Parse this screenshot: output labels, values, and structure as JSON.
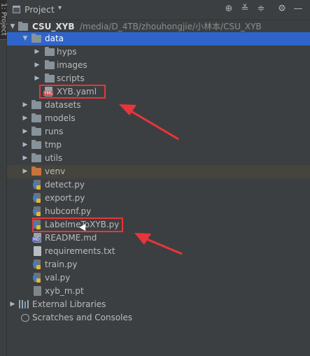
{
  "side_tab": {
    "label": "1: Project"
  },
  "header": {
    "title": "Project",
    "caret": "▾"
  },
  "toolbar_icons": [
    "crosshair-icon",
    "expand-all-icon",
    "collapse-all-icon",
    "gear-icon",
    "hide-icon"
  ],
  "tree": {
    "root": {
      "name": "CSU_XYB",
      "path": "/media/D_4TB/zhouhongjie/小林本/CSU_XYB"
    },
    "items": [
      {
        "label": "data"
      },
      {
        "label": "hyps"
      },
      {
        "label": "images"
      },
      {
        "label": "scripts"
      },
      {
        "label": "XYB.yaml"
      },
      {
        "label": "datasets"
      },
      {
        "label": "models"
      },
      {
        "label": "runs"
      },
      {
        "label": "tmp"
      },
      {
        "label": "utils"
      },
      {
        "label": "venv"
      },
      {
        "label": "detect.py"
      },
      {
        "label": "export.py"
      },
      {
        "label": "hubconf.py"
      },
      {
        "label": "LabelmeToXYB.py"
      },
      {
        "label": "README.md"
      },
      {
        "label": "requirements.txt"
      },
      {
        "label": "train.py"
      },
      {
        "label": "val.py"
      },
      {
        "label": "xyb_m.pt"
      }
    ],
    "external_libraries": "External Libraries",
    "scratches": "Scratches and Consoles"
  },
  "colors": {
    "selection": "#2f65ca",
    "annotation_red": "#e8353a",
    "venv_folder": "#c8743c"
  }
}
